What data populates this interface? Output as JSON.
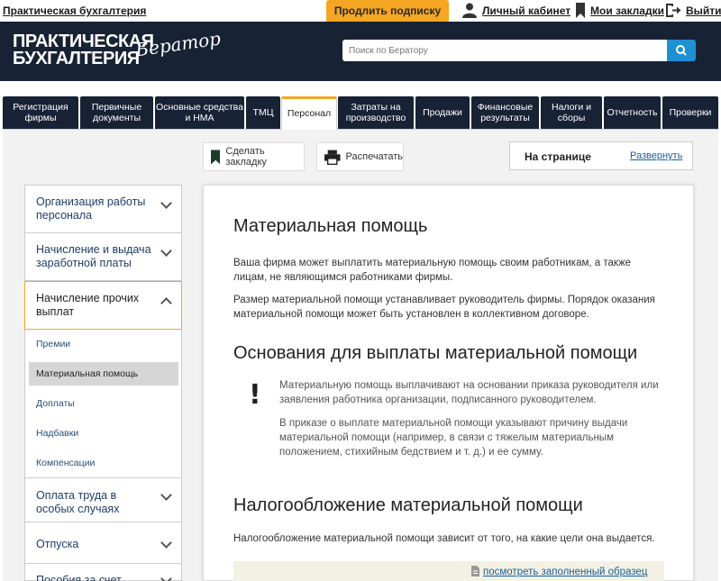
{
  "topbar": {
    "brand_link": "Практическая бухгалтерия",
    "promo_label": "Продлить подписку",
    "account_label": "Личный кабинет",
    "bookmarks_label": "Мои закладки",
    "logout_label": "Выйти"
  },
  "header": {
    "logo_line1": "ПРАКТИЧЕСКАЯ",
    "logo_line2": "БУХГАЛТЕРИЯ",
    "logo_script": "Бератор",
    "search_placeholder": "Поиск по Бератору"
  },
  "nav": {
    "tabs": [
      {
        "label": "Регистрация фирмы"
      },
      {
        "label": "Первичные документы"
      },
      {
        "label": "Основные средства и НМА"
      },
      {
        "label": "ТМЦ"
      },
      {
        "label": "Персонал",
        "active": true
      },
      {
        "label": "Затраты на производство"
      },
      {
        "label": "Продажи"
      },
      {
        "label": "Финансовые результаты"
      },
      {
        "label": "Налоги и сборы"
      },
      {
        "label": "Отчетность"
      },
      {
        "label": "Проверки"
      }
    ]
  },
  "actions": {
    "bookmark_label": "Сделать закладку",
    "print_label": "Распечатать"
  },
  "on_page": {
    "title": "На странице",
    "expand_label": "Развернуть"
  },
  "sidebar": {
    "items": [
      {
        "label": "Организация работы персонала"
      },
      {
        "label": "Начисление и выдача заработной платы"
      },
      {
        "label": "Начисление прочих выплат",
        "active": true
      },
      {
        "label": "Оплата труда в особых случаях"
      },
      {
        "label": "Отпуска"
      },
      {
        "label": "Пособия за счет"
      }
    ],
    "subitems": [
      {
        "label": "Премии"
      },
      {
        "label": "Материальная помощь",
        "active": true
      },
      {
        "label": "Доплаты"
      },
      {
        "label": "Надбавки"
      },
      {
        "label": "Компенсации"
      }
    ]
  },
  "article": {
    "title": "Материальная помощь",
    "p1": "Ваша фирма может выплатить материальную помощь своим работникам, а также лицам, не являющимся работниками фирмы.",
    "p2": "Размер материальной помощи устанавливает руководитель фирмы. Порядок оказания материальной помощи может быть установлен в коллективном договоре.",
    "h2": "Основания для выплаты материальной помощи",
    "note_mark": "!",
    "note1": "Материальную помощь выплачивают на основании приказа руководителя или заявления работника организации, подписанного руководителем.",
    "note2": "В приказе о выплате материальной помощи указывают причину выдачи материальной помощи (например, в связи с тяжелым материальным положением, стихийным бедствием и т. д.) и ее сумму.",
    "h3": "Налогообложение материальной помощи",
    "p3": "Налогообложение материальной помощи зависит от того, на какие цели она выдается.",
    "sample_link": "посмотреть заполненный образец"
  },
  "colors": {
    "header_bg": "#182235",
    "accent": "#f5a623",
    "search_button": "#1e90d4",
    "link": "#1a5e9a"
  }
}
